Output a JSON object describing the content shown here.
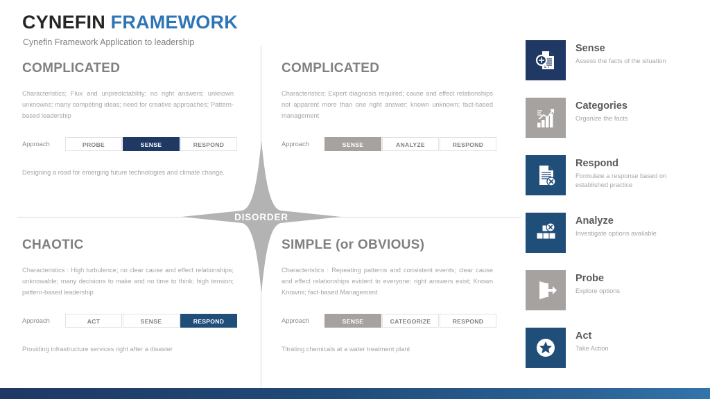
{
  "header": {
    "title_part1": "CYNEFIN",
    "title_part2": "FRAMEWORK",
    "subtitle": "Cynefin Framework Application to leadership",
    "accent_color": "#2e75b6",
    "title_color": "#262626"
  },
  "center": {
    "label": "DISORDER",
    "star_color": "#b3b3b3"
  },
  "quadrants": [
    {
      "id": "top-left",
      "title": "COMPLICATED",
      "characteristics": "Characteristics; Flux and unpredictability; no right answers; unknown unknowns; many competing ideas; need for creative approaches; Pattern-based leadership",
      "approach_label": "Approach",
      "buttons": [
        {
          "label": "PROBE",
          "state": "inactive"
        },
        {
          "label": "SENSE",
          "state": "active-navy"
        },
        {
          "label": "RESPOND",
          "state": "inactive"
        }
      ],
      "example": "Designing a road for emerging future technologies and climate change."
    },
    {
      "id": "top-right",
      "title": "COMPLICATED",
      "characteristics": "Characteristics; Expert diagnosis required; cause and effect relationships not apparent more than one right answer; known unknown; fact-based management",
      "approach_label": "Approach",
      "buttons": [
        {
          "label": "SENSE",
          "state": "active-gray"
        },
        {
          "label": "ANALYZE",
          "state": "inactive"
        },
        {
          "label": "RESPOND",
          "state": "inactive"
        }
      ],
      "example": ""
    },
    {
      "id": "bottom-left",
      "title": "CHAOTIC",
      "characteristics": "Characteristics : High turbulence; no clear cause and effect relationships; unknowable; many decisions to make and no time to think; high tension; pattern-based leadership",
      "approach_label": "Approach",
      "buttons": [
        {
          "label": "ACT",
          "state": "inactive"
        },
        {
          "label": "SENSE",
          "state": "inactive"
        },
        {
          "label": "RESPOND",
          "state": "active-blue"
        }
      ],
      "example": "Providing infrastructure services right after a disaster"
    },
    {
      "id": "bottom-right",
      "title": "SIMPLE (or OBVIOUS)",
      "characteristics": "Characteristics : Repeating patterns and consistent events; clear cause and effect relationships evident to everyone; right answers exist; Known Knowns; fact-based Management",
      "approach_label": "Approach",
      "buttons": [
        {
          "label": "SENSE",
          "state": "active-gray"
        },
        {
          "label": "CATEGORIZE",
          "state": "inactive"
        },
        {
          "label": "RESPOND",
          "state": "inactive"
        }
      ],
      "example": "Titrating chemicals at a water treatment plant"
    }
  ],
  "sidebar": {
    "items": [
      {
        "title": "Sense",
        "desc": "Assess the facts of the situation",
        "icon": "document-search-icon",
        "box_color": "#1f3864"
      },
      {
        "title": "Categories",
        "desc": "Organize the facts",
        "icon": "bar-chart-growth-icon",
        "box_color": "#a6a2a0"
      },
      {
        "title": "Respond",
        "desc": "Formulate a response based on established practice",
        "icon": "document-x-icon",
        "box_color": "#1f4e79"
      },
      {
        "title": "Analyze",
        "desc": "Investigate options available",
        "icon": "blocks-x-icon",
        "box_color": "#1f4e79"
      },
      {
        "title": "Probe",
        "desc": "Explore options",
        "icon": "exit-arrow-icon",
        "box_color": "#a6a2a0"
      },
      {
        "title": "Act",
        "desc": "Take Action",
        "icon": "star-circle-icon",
        "box_color": "#1f4e79"
      }
    ]
  },
  "footer": {
    "gradient_from": "#1f3864",
    "gradient_to": "#3274ab"
  }
}
